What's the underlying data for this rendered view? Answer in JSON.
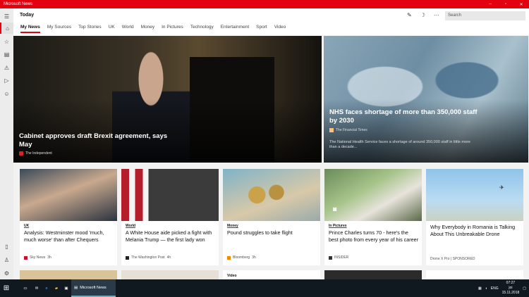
{
  "window": {
    "title": "Microsoft News",
    "controls": [
      "–",
      "▫",
      "✕"
    ]
  },
  "header": {
    "page_title": "Today",
    "search_placeholder": "Search",
    "more_label": "···"
  },
  "tabs": [
    "My News",
    "My Sources",
    "Top Stories",
    "UK",
    "World",
    "Money",
    "In Pictures",
    "Technology",
    "Entertainment",
    "Sport",
    "Video"
  ],
  "hero": [
    {
      "title": "Cabinet approves draft Brexit agreement, says May",
      "source": "The Independent"
    },
    {
      "title": "NHS faces shortage of more than 350,000 staff by 2030",
      "source": "The Financial Times",
      "description": "The National Health Service faces a shortage of around 350,000 staff in little more than a decade..."
    }
  ],
  "cards": [
    {
      "category": "UK",
      "title": "Analysis: Westminster mood 'much, much worse' than after Chequers",
      "source": "Sky News",
      "age": "3h",
      "color": "#c8102e"
    },
    {
      "category": "World",
      "title": "A White House aide picked a fight with Melania Trump — the first lady won",
      "source": "The Washington Post",
      "age": "4h",
      "color": "#222222"
    },
    {
      "category": "Money",
      "title": "Pound struggles to take flight",
      "source": "Bloomberg",
      "age": "3h",
      "color": "#f18a00"
    },
    {
      "category": "In Pictures",
      "title": "Prince Charles turns 70 - here's the best photo from every year of his career",
      "source": "INSIDER",
      "age": "",
      "color": "#333333"
    },
    {
      "category": "",
      "title": "Why Everybody in Romania is Talking About This Unbreakable Drone",
      "source": "Drone X Pro | SPONSORED",
      "age": "",
      "color": ""
    }
  ],
  "next_row": [
    {
      "category": ""
    },
    {
      "category": ""
    },
    {
      "category": "Video"
    },
    {
      "category": ""
    },
    {
      "category": ""
    }
  ],
  "taskbar": {
    "app_label": "Microsoft News",
    "lang": "ENG",
    "time": "07:27",
    "day": "joi",
    "date": "15.11.2018"
  }
}
